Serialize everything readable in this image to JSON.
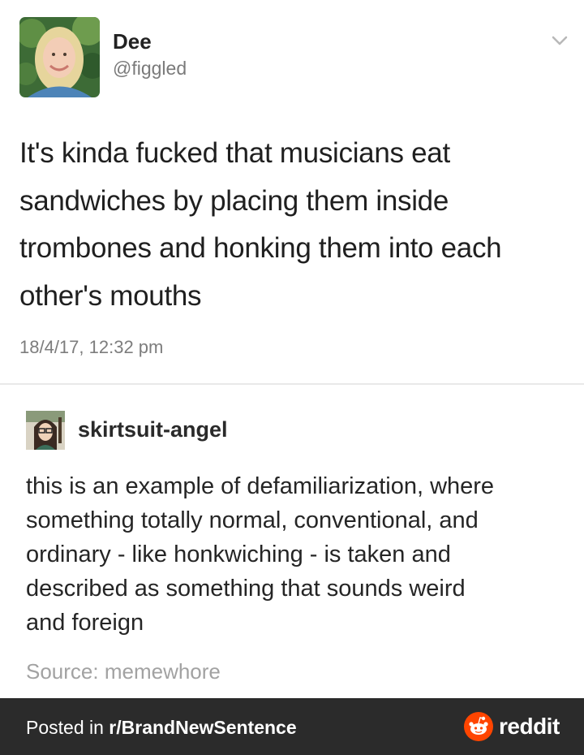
{
  "tweet": {
    "display_name": "Dee",
    "handle": "@figgled",
    "text": "It's kinda fucked that musicians eat\nsandwiches by placing them inside\ntrombones and honking them into each\nother's mouths",
    "timestamp": "18/4/17, 12:32 pm",
    "avatar_icon": "profile-photo-avatar",
    "menu_icon": "chevron-down-icon"
  },
  "reblog": {
    "username": "skirtsuit-angel",
    "text": "this is an example of defamiliarization, where\nsomething totally normal, conventional, and\nordinary - like honkwiching - is taken and\ndescribed as something that sounds weird\nand foreign",
    "source": "Source: memewhore",
    "avatar_icon": "illustrated-avatar"
  },
  "footer": {
    "posted_prefix": "Posted in ",
    "subreddit": "r/BrandNewSentence",
    "brand": "reddit",
    "brand_icon": "reddit-snoo-icon",
    "brand_color": "#ff4500",
    "background": "#2b2b2b"
  }
}
